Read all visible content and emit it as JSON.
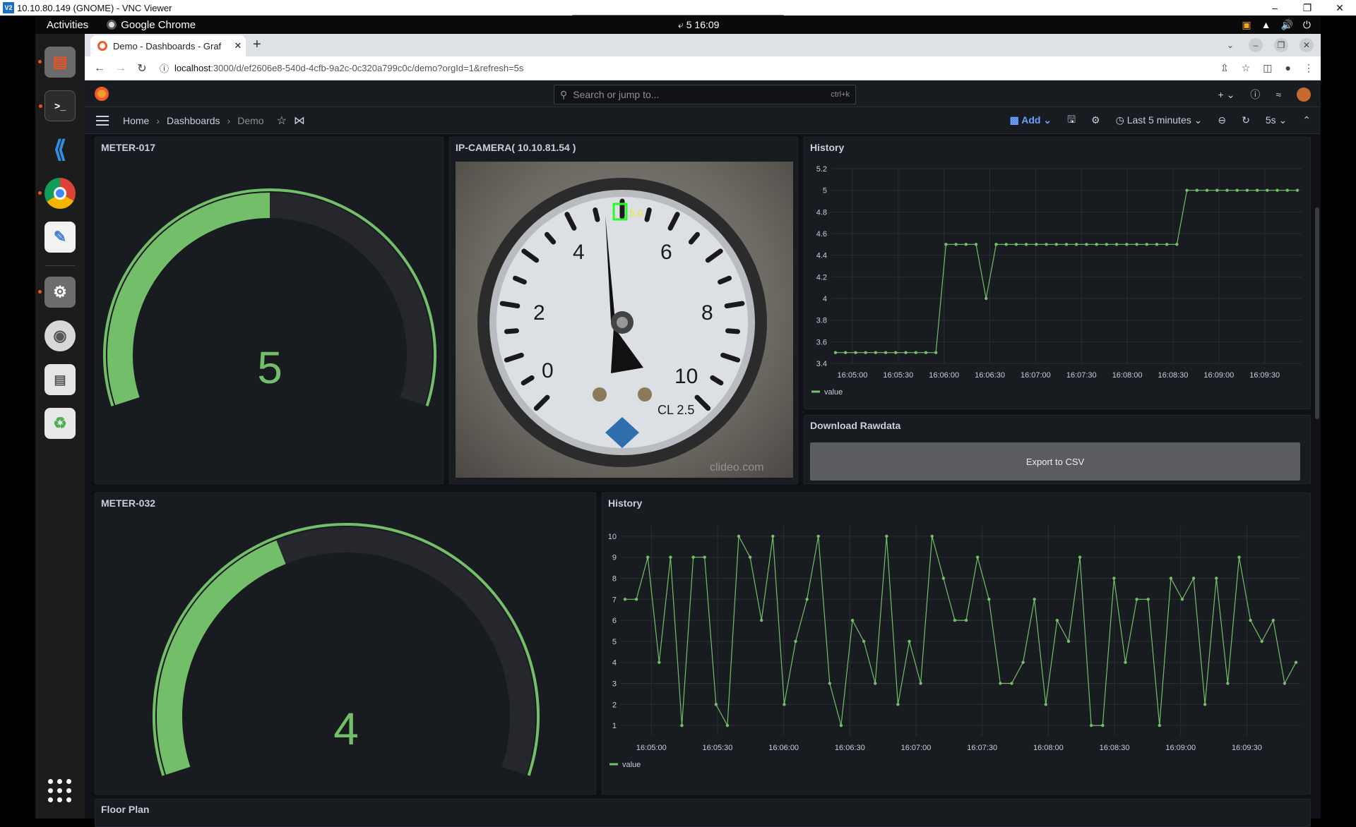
{
  "vnc": {
    "title": "10.10.80.149 (GNOME) - VNC Viewer",
    "logo": "V2"
  },
  "gnome": {
    "activities": "Activities",
    "app_name": "Google Chrome",
    "clock": "⤶ 5  16:09"
  },
  "dock": {
    "items": [
      "files-icon",
      "terminal-icon",
      "vscode-icon",
      "chrome-icon",
      "text-editor-icon",
      "settings-icon",
      "disc-icon",
      "drive-icon",
      "trash-icon"
    ]
  },
  "browser": {
    "tab_title": "Demo - Dashboards - Graf",
    "url_host": "localhost",
    "url_path": ":3000/d/ef2606e8-540d-4cfb-9a2c-0c320a799c0c/demo?orgId=1&refresh=5s"
  },
  "grafana": {
    "search_placeholder": "Search or jump to...",
    "search_shortcut": "ctrl+k",
    "breadcrumb": [
      "Home",
      "Dashboards",
      "Demo"
    ],
    "add_label": "Add",
    "time_range": "Last 5 minutes",
    "refresh_interval": "5s",
    "accent": "#73bf69"
  },
  "panels": {
    "meter017": {
      "title": "METER-017",
      "value": "5",
      "gauge_fraction": 0.5
    },
    "camera": {
      "title": "IP-CAMERA( 10.10.81.54 )",
      "detection_label": "5.0",
      "dial_labels": [
        "0",
        "2",
        "4",
        "6",
        "8",
        "10"
      ],
      "dial_brand": "CL 2.5",
      "dial_watermark": "clideo.com"
    },
    "history1": {
      "title": "History",
      "legend": "value"
    },
    "download": {
      "title": "Download Rawdata",
      "button": "Export to CSV"
    },
    "meter032": {
      "title": "METER-032",
      "value": "4",
      "gauge_fraction": 0.4
    },
    "history2": {
      "title": "History",
      "legend": "value"
    },
    "floor": {
      "title": "Floor Plan"
    }
  },
  "chart_data": [
    {
      "type": "line",
      "title": "History",
      "series": [
        {
          "name": "value",
          "values": [
            3.5,
            3.5,
            3.5,
            3.5,
            3.5,
            3.5,
            3.5,
            3.5,
            3.5,
            3.5,
            3.5,
            4.5,
            4.5,
            4.5,
            4.5,
            4.0,
            4.5,
            4.5,
            4.5,
            4.5,
            4.5,
            4.5,
            4.5,
            4.5,
            4.5,
            4.5,
            4.5,
            4.5,
            4.5,
            4.5,
            4.5,
            4.5,
            4.5,
            4.5,
            4.5,
            5.0,
            5.0,
            5.0,
            5.0,
            5.0,
            5.0,
            5.0,
            5.0,
            5.0,
            5.0,
            5.0,
            5.0
          ]
        }
      ],
      "x_ticks": [
        "16:05:00",
        "16:05:30",
        "16:06:00",
        "16:06:30",
        "16:07:00",
        "16:07:30",
        "16:08:00",
        "16:08:30",
        "16:09:00",
        "16:09:30"
      ],
      "y_ticks": [
        "3.4",
        "3.6",
        "3.8",
        "4",
        "4.2",
        "4.4",
        "4.6",
        "4.8",
        "5",
        "5.2"
      ],
      "ylim": [
        3.4,
        5.2
      ]
    },
    {
      "type": "line",
      "title": "History",
      "series": [
        {
          "name": "value",
          "values": [
            7,
            7,
            9,
            4,
            9,
            1,
            9,
            9,
            2,
            1,
            10,
            9,
            6,
            10,
            2,
            5,
            7,
            10,
            3,
            1,
            6,
            5,
            3,
            10,
            2,
            5,
            3,
            10,
            8,
            6,
            6,
            9,
            7,
            3,
            3,
            4,
            7,
            2,
            6,
            5,
            9,
            1,
            1,
            8,
            4,
            7,
            7,
            1,
            8,
            7,
            8,
            2,
            8,
            3,
            9,
            6,
            5,
            6,
            3,
            4
          ]
        }
      ],
      "x_ticks": [
        "16:05:00",
        "16:05:30",
        "16:06:00",
        "16:06:30",
        "16:07:00",
        "16:07:30",
        "16:08:00",
        "16:08:30",
        "16:09:00",
        "16:09:30"
      ],
      "y_ticks": [
        "1",
        "2",
        "3",
        "4",
        "5",
        "6",
        "7",
        "8",
        "9",
        "10"
      ],
      "ylim": [
        0.5,
        10.5
      ]
    }
  ]
}
